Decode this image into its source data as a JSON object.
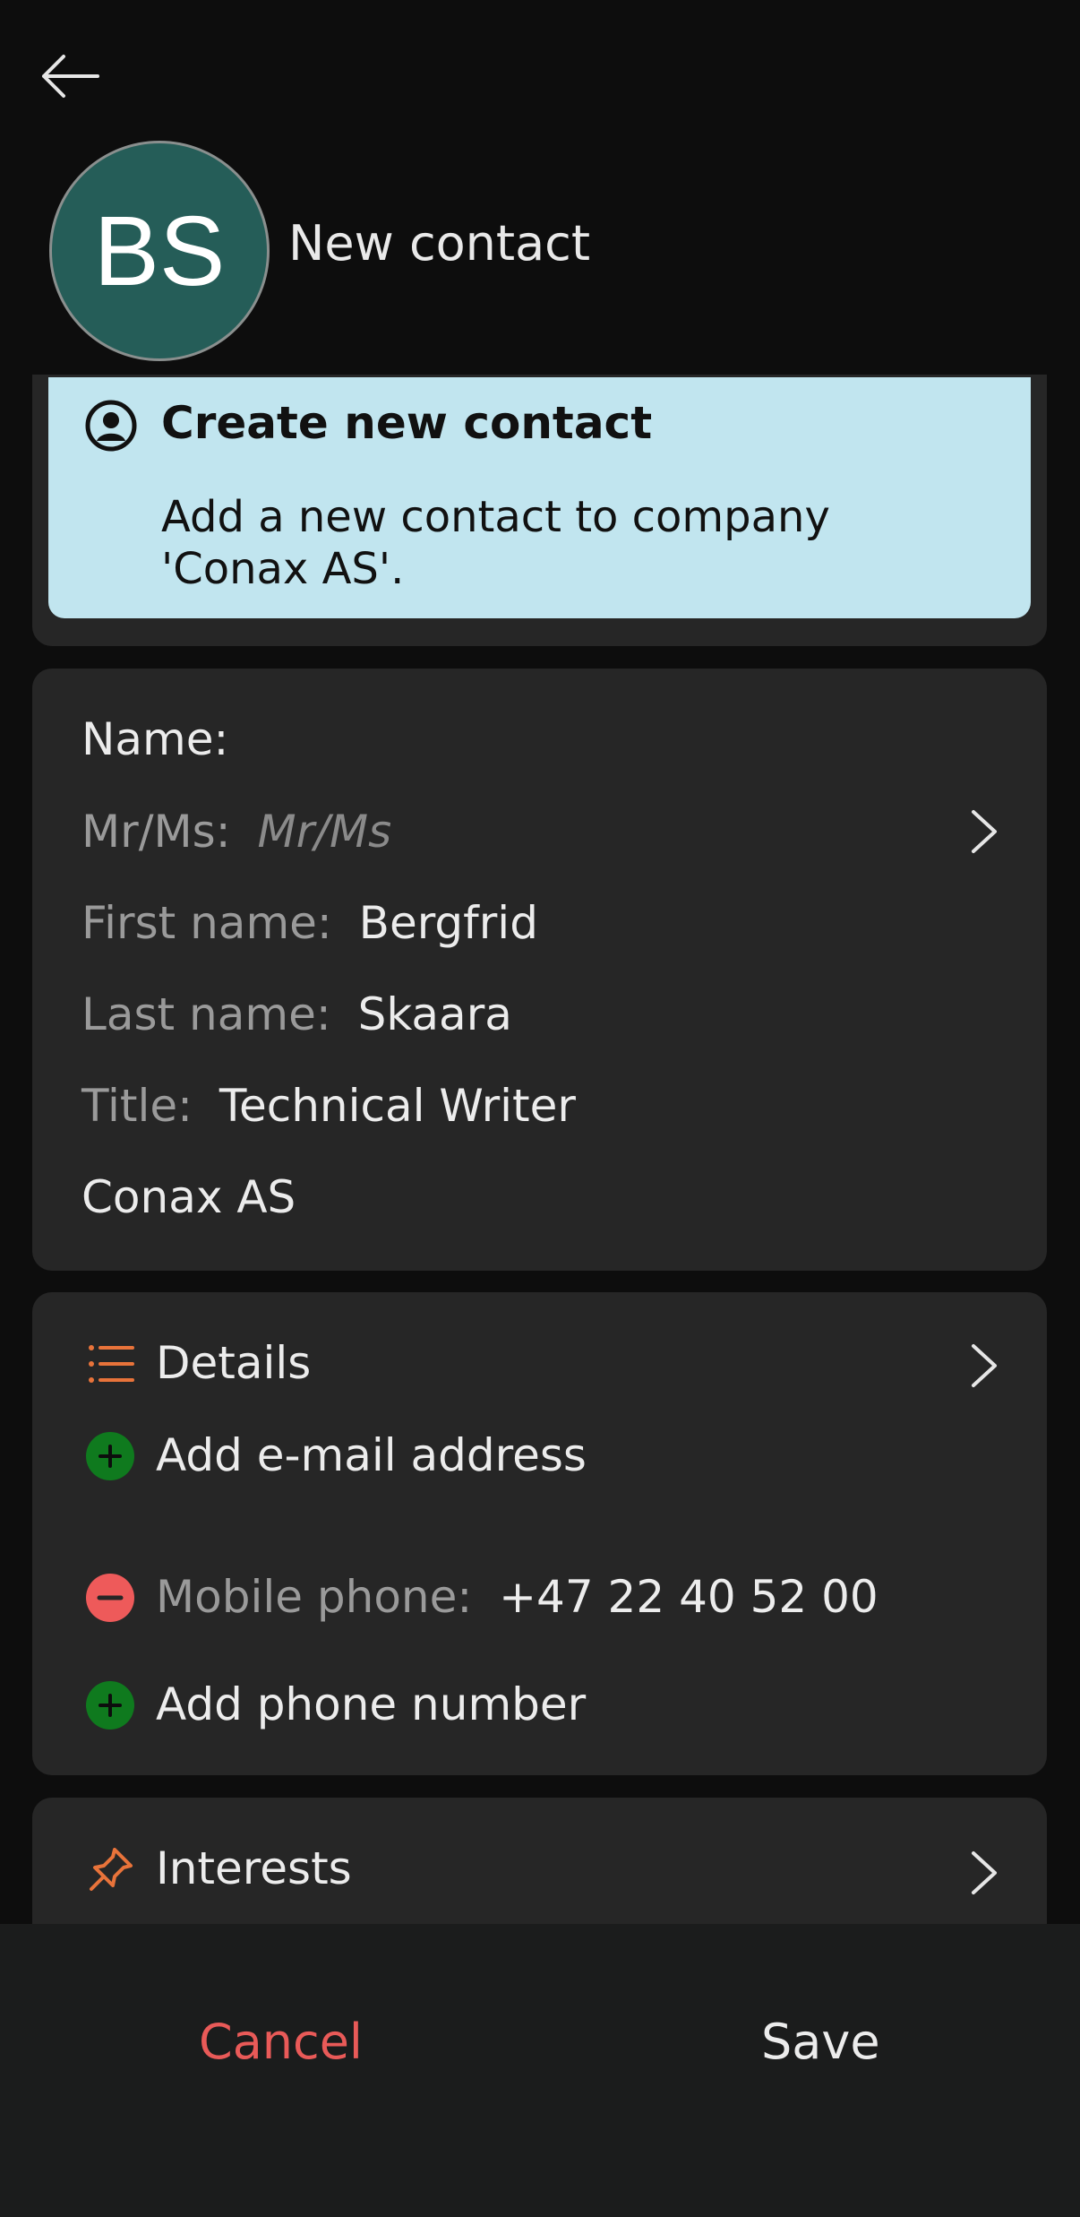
{
  "header": {
    "avatar_initials": "BS",
    "title": "New contact",
    "back_icon": "arrow-left-icon"
  },
  "info": {
    "icon": "person-circle-icon",
    "title": "Create new contact",
    "description": "Add a new contact to company 'Conax AS'."
  },
  "name_section": {
    "heading": "Name:",
    "salutation_label": "Mr/Ms:",
    "salutation_placeholder": "Mr/Ms",
    "first_name_label": "First name:",
    "first_name_value": "Bergfrid",
    "last_name_label": "Last name:",
    "last_name_value": "Skaara",
    "title_label": "Title:",
    "title_value": "Technical Writer",
    "company": "Conax AS"
  },
  "details_section": {
    "heading": "Details",
    "add_email": "Add e-mail address",
    "mobile_label": "Mobile phone:",
    "mobile_value": "+47 22 40 52 00",
    "add_phone": "Add phone number"
  },
  "interests_section": {
    "heading": "Interests"
  },
  "footer": {
    "cancel": "Cancel",
    "save": "Save"
  },
  "colors": {
    "background": "#0d0d0d",
    "panel": "#262626",
    "info_box": "#c1e5ef",
    "avatar": "#255d58",
    "accent_orange": "#e8733a",
    "add_green": "#0f7a1e",
    "remove_red": "#ee5a5a",
    "cancel_red": "#e95a58"
  }
}
